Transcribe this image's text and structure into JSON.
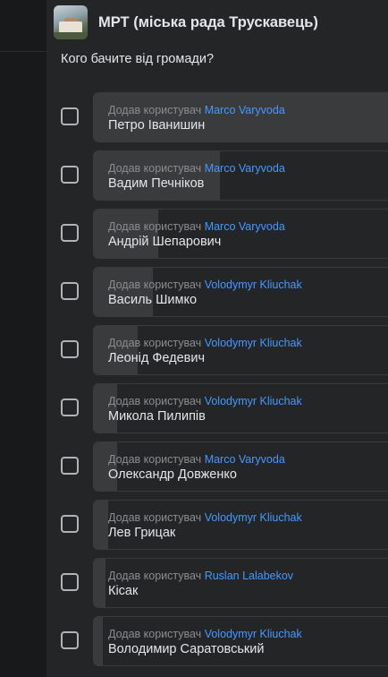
{
  "group": {
    "title": "МРТ (міська рада Трускавець)",
    "avatar_icon": "group-photo-icon"
  },
  "poll": {
    "question": "Кого бачите від громади?",
    "added_prefix": "Додав користувач",
    "options": [
      {
        "added_by": "Marco Varyvoda",
        "name": "Петро Іванишин",
        "vote_share": 1.0
      },
      {
        "added_by": "Marco Varyvoda",
        "name": "Вадим Печніков",
        "vote_share": 0.43
      },
      {
        "added_by": "Marco Varyvoda",
        "name": "Андрій Шепарович",
        "vote_share": 0.22
      },
      {
        "added_by": "Volodymyr Kliuchak",
        "name": "Василь Шимко",
        "vote_share": 0.2
      },
      {
        "added_by": "Volodymyr Kliuchak",
        "name": "Леонід Федевич",
        "vote_share": 0.15
      },
      {
        "added_by": "Volodymyr Kliuchak",
        "name": "Микола Пилипів",
        "vote_share": 0.08
      },
      {
        "added_by": "Marco Varyvoda",
        "name": "Олександр Довженко",
        "vote_share": 0.08
      },
      {
        "added_by": "Volodymyr Kliuchak",
        "name": "Лев Грицак",
        "vote_share": 0.05
      },
      {
        "added_by": "Ruslan Lalabekov",
        "name": "Кісак",
        "vote_share": 0.04
      },
      {
        "added_by": "Volodymyr Kliuchak",
        "name": "Володимир Саратовський",
        "vote_share": 0.03
      }
    ]
  },
  "colors": {
    "panel_bg": "#242526",
    "bar_fill": "#3a3b3c",
    "user_link": "#4599ff",
    "muted_text": "#8a8d91"
  }
}
